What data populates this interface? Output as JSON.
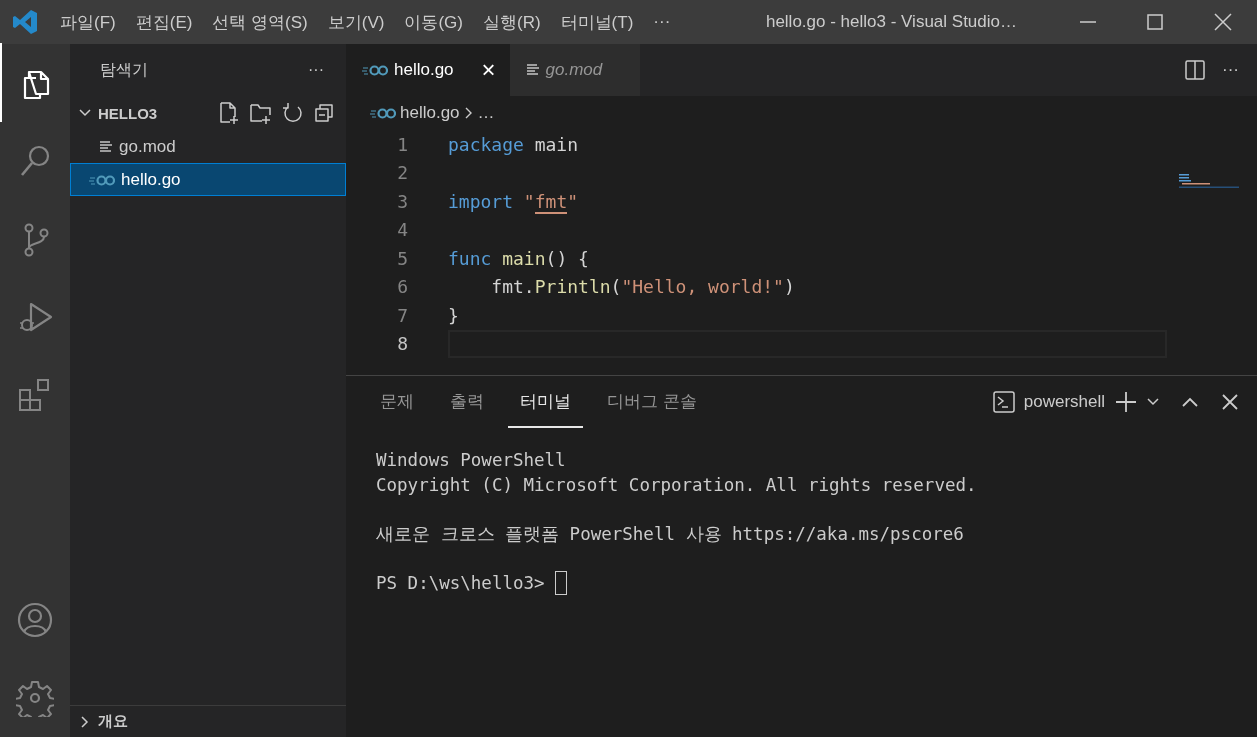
{
  "window": {
    "title": "hello.go - hello3 - Visual Studio…"
  },
  "menu": [
    "파일(F)",
    "편집(E)",
    "선택 영역(S)",
    "보기(V)",
    "이동(G)",
    "실행(R)",
    "터미널(T)",
    "···"
  ],
  "activity_bar": [
    {
      "selected": true
    },
    {
      "selected": false
    },
    {
      "selected": false
    },
    {
      "selected": false
    },
    {
      "selected": false
    }
  ],
  "sidebar": {
    "title": "탐색기",
    "more": "···",
    "folder": {
      "name": "HELLO3",
      "expanded": true,
      "items": [
        {
          "name": "go.mod",
          "kind": "text",
          "selected": false
        },
        {
          "name": "hello.go",
          "kind": "go",
          "selected": true
        }
      ]
    },
    "outline": {
      "name": "개요",
      "expanded": false
    }
  },
  "editor": {
    "tabs": [
      {
        "name": "hello.go",
        "kind": "go",
        "selected": true,
        "preview": false,
        "close": "×"
      },
      {
        "name": "go.mod",
        "kind": "text",
        "selected": false,
        "preview": true
      }
    ],
    "more": "···",
    "breadcrumb": {
      "file": "hello.go",
      "rest": "…"
    },
    "lines": [
      {
        "number": "1",
        "current": false,
        "tokens": [
          {
            "kind": "keyword",
            "text": "package"
          },
          {
            "kind": "plain",
            "text": " main"
          }
        ]
      },
      {
        "number": "2",
        "current": false
      },
      {
        "number": "3",
        "current": false,
        "tokens": [
          {
            "kind": "keyword",
            "text": "import"
          },
          {
            "kind": "string",
            "text": " \""
          },
          {
            "kind": "marked",
            "text": "fmt"
          },
          {
            "kind": "string",
            "text": "\""
          }
        ]
      },
      {
        "number": "4",
        "current": false
      },
      {
        "number": "5",
        "current": false,
        "tokens": [
          {
            "kind": "keyword",
            "text": "func"
          },
          {
            "kind": "function",
            "text": " main"
          },
          {
            "kind": "plain",
            "text": "() {"
          }
        ]
      },
      {
        "number": "6",
        "current": false,
        "tokens": [
          {
            "kind": "plain",
            "text": "    fmt."
          },
          {
            "kind": "function",
            "text": "Println"
          },
          {
            "kind": "plain",
            "text": "("
          },
          {
            "kind": "string",
            "text": "\"Hello, world!\""
          },
          {
            "kind": "plain",
            "text": ")"
          }
        ]
      },
      {
        "number": "7",
        "current": false,
        "tokens": [
          {
            "kind": "plain",
            "text": "}"
          }
        ]
      },
      {
        "number": "8",
        "current": true
      }
    ]
  },
  "panel": {
    "tabs": [
      {
        "label": "문제",
        "selected": false
      },
      {
        "label": "출력",
        "selected": false
      },
      {
        "label": "터미널",
        "selected": true
      },
      {
        "label": "디버그 콘솔",
        "selected": false
      }
    ],
    "shell": "powershell",
    "terminal": [
      {
        "lines": [
          "Windows PowerShell",
          "Copyright (C) Microsoft Corporation. All rights reserved."
        ]
      },
      {
        "lines": [
          "새로운 크로스 플랫폼 PowerShell 사용 https://aka.ms/pscore6"
        ]
      }
    ],
    "prompt": "PS D:\\ws\\hello3> "
  }
}
